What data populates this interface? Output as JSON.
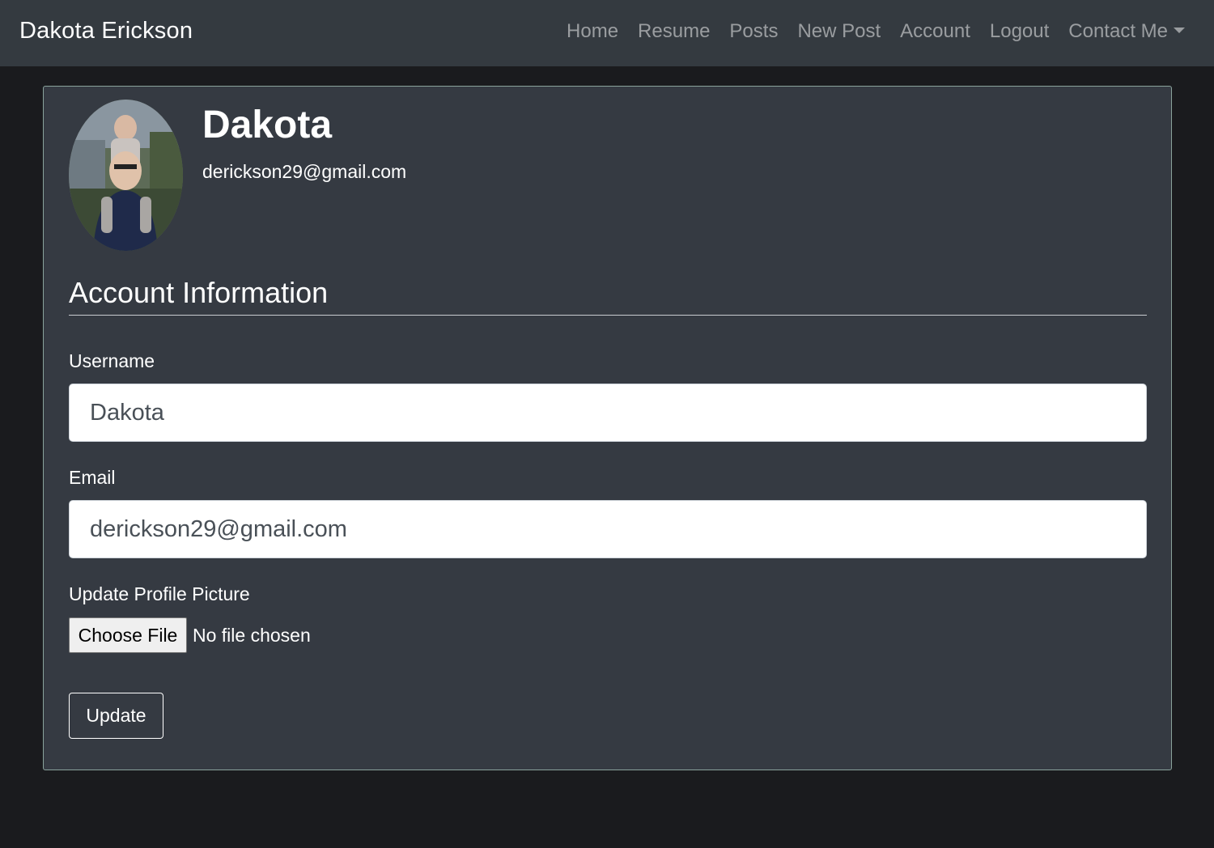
{
  "navbar": {
    "brand": "Dakota Erickson",
    "links": [
      "Home",
      "Resume",
      "Posts",
      "New Post",
      "Account",
      "Logout"
    ],
    "dropdown_label": "Contact Me"
  },
  "profile": {
    "name": "Dakota",
    "email": "derickson29@gmail.com",
    "avatar_alt": "profile-photo"
  },
  "form": {
    "section_title": "Account Information",
    "username_label": "Username",
    "username_value": "Dakota",
    "email_label": "Email",
    "email_value": "derickson29@gmail.com",
    "picture_label": "Update Profile Picture",
    "choose_file_label": "Choose File",
    "no_file_text": "No file chosen",
    "submit_label": "Update"
  },
  "colors": {
    "navbar_bg": "#343a40",
    "page_bg": "#1a1b1e",
    "card_bg": "#353a42",
    "card_border": "#8aa39c",
    "nav_link": "#9a9da0"
  }
}
